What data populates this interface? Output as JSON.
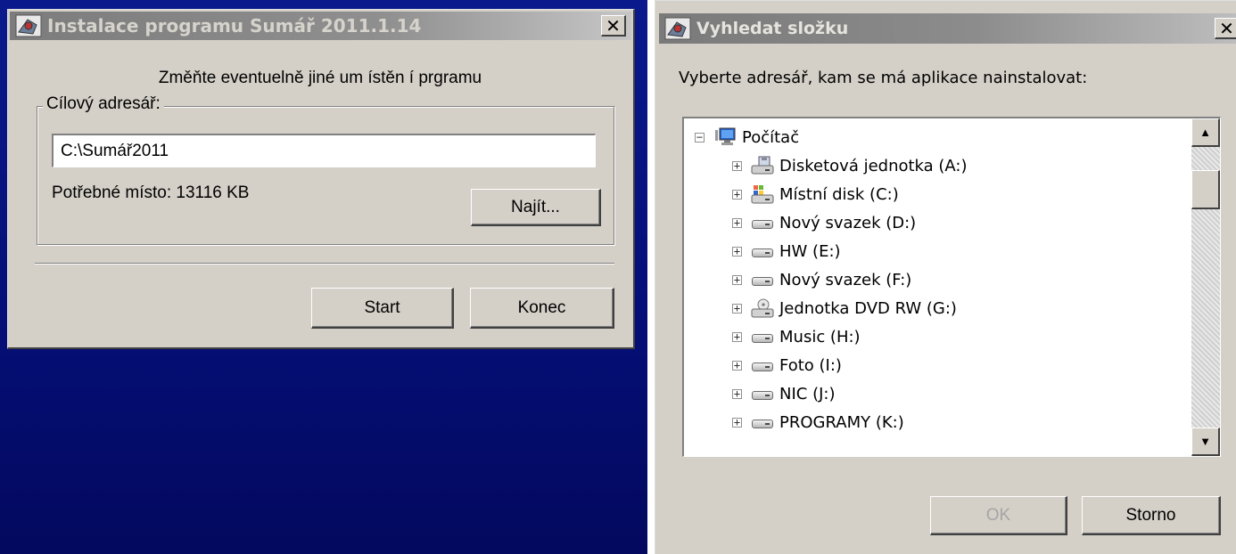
{
  "installer": {
    "title": "Instalace  programu Sumář  2011.1.14",
    "close_glyph": "✕",
    "heading": "Změňte eventuelně jiné um ístěn í prgramu",
    "group_label": "Cílový adresář:",
    "path_value": "C:\\Sumář2011",
    "space_required": "Potřebné místo: 13116 KB",
    "find_label": "Najít...",
    "start_label": "Start",
    "konec_label": "Konec",
    "icon": "app-icon"
  },
  "folder_dialog": {
    "title": "Vyhledat složku",
    "close_glyph": "✕",
    "prompt": "Vyberte adresář, kam se má aplikace nainstalovat:",
    "tree": {
      "root": {
        "label": "Počítač",
        "expander": "−",
        "icon": "computer-icon"
      },
      "items": [
        {
          "label": "Disketová jednotka (A:)",
          "expander": "+",
          "icon": "floppy-drive-icon"
        },
        {
          "label": "Místní disk (C:)",
          "expander": "+",
          "icon": "system-disk-icon"
        },
        {
          "label": "Nový svazek (D:)",
          "expander": "+",
          "icon": "hard-drive-icon"
        },
        {
          "label": "HW (E:)",
          "expander": "+",
          "icon": "hard-drive-icon"
        },
        {
          "label": "Nový svazek (F:)",
          "expander": "+",
          "icon": "hard-drive-icon"
        },
        {
          "label": "Jednotka DVD RW (G:)",
          "expander": "+",
          "icon": "dvd-drive-icon"
        },
        {
          "label": "Music (H:)",
          "expander": "+",
          "icon": "hard-drive-icon"
        },
        {
          "label": "Foto (I:)",
          "expander": "+",
          "icon": "hard-drive-icon"
        },
        {
          "label": "NIC (J:)",
          "expander": "+",
          "icon": "hard-drive-icon"
        },
        {
          "label": "PROGRAMY (K:)",
          "expander": "+",
          "icon": "hard-drive-icon"
        }
      ]
    },
    "ok_label": "OK",
    "storno_label": "Storno",
    "scroll_up_glyph": "▲",
    "scroll_down_glyph": "▼"
  },
  "colors": {
    "desktop": "#0a1a8c",
    "dialog_face": "#d4d0c8",
    "inactive_title": "#8f8f8f"
  }
}
